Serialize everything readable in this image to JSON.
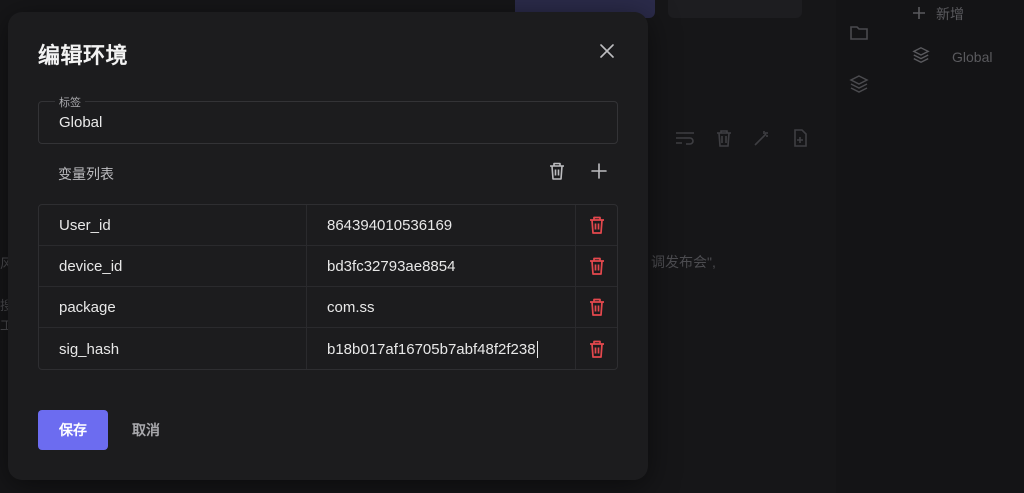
{
  "background": {
    "sidebar": {
      "new_label": "新增",
      "env_label": "Global"
    },
    "text_fragment": "调发布会\",",
    "left_fragments": [
      "风",
      "搜",
      "工"
    ]
  },
  "modal": {
    "title": "编辑环境",
    "tag": {
      "label": "标签",
      "value": "Global"
    },
    "variables": {
      "title": "变量列表",
      "rows": [
        {
          "key": "User_id",
          "value": "864394010536169"
        },
        {
          "key": "device_id",
          "value": "bd3fc32793ae8854"
        },
        {
          "key": "package",
          "value": "com.ss"
        },
        {
          "key": "sig_hash",
          "value": "b18b017af16705b7abf48f2f238"
        }
      ]
    },
    "save_label": "保存",
    "cancel_label": "取消"
  },
  "colors": {
    "primary": "#6c6cf0",
    "danger": "#e5484d",
    "modal_bg": "#1c1c1e"
  }
}
